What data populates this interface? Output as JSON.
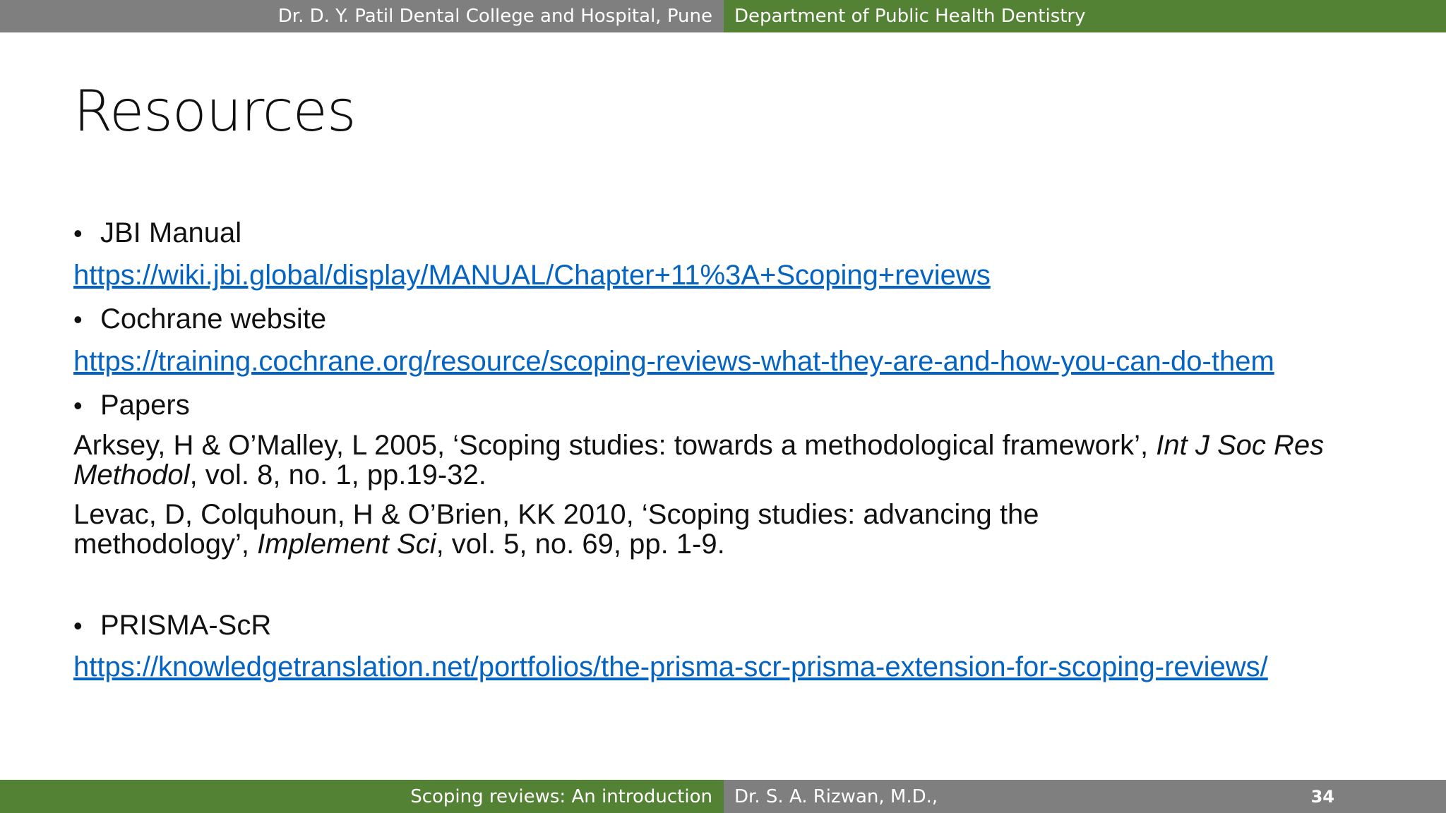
{
  "header": {
    "left": "Dr. D. Y. Patil Dental College and Hospital, Pune",
    "right": "Department of Public Health Dentistry"
  },
  "title": "Resources",
  "items": {
    "jbi": {
      "bullet": "JBI Manual",
      "link": "https://wiki.jbi.global/display/MANUAL/Chapter+11%3A+Scoping+reviews"
    },
    "cochrane": {
      "bullet": "Cochrane website",
      "link": "https://training.cochrane.org/resource/scoping-reviews-what-they-are-and-how-you-can-do-them"
    },
    "papers": {
      "bullet": "Papers",
      "ref1": {
        "pre": "Arksey, H & O’Malley, L 2005, ‘Scoping studies: towards a methodological framework’, ",
        "journal": "Int J Soc Res Methodol",
        "post": ", vol. 8, no. 1, pp.19-32."
      },
      "ref2": {
        "pre": "Levac, D, Colquhoun, H & O’Brien, KK 2010, ‘Scoping studies: advancing the methodology’, ",
        "journal": "Implement Sci",
        "post": ", vol. 5, no. 69, pp. 1-9."
      }
    },
    "prisma": {
      "bullet": "PRISMA-ScR",
      "link": "https://knowledgetranslation.net/portfolios/the-prisma-scr-prisma-extension-for-scoping-reviews/"
    }
  },
  "bullet_glyph": "•",
  "footer": {
    "left": "Scoping reviews: An introduction",
    "right": "Dr. S. A. Rizwan, M.D.,",
    "slide_number": "34"
  },
  "colors": {
    "grey": "#7f7f7f",
    "green": "#548235",
    "link": "#0563c1"
  }
}
